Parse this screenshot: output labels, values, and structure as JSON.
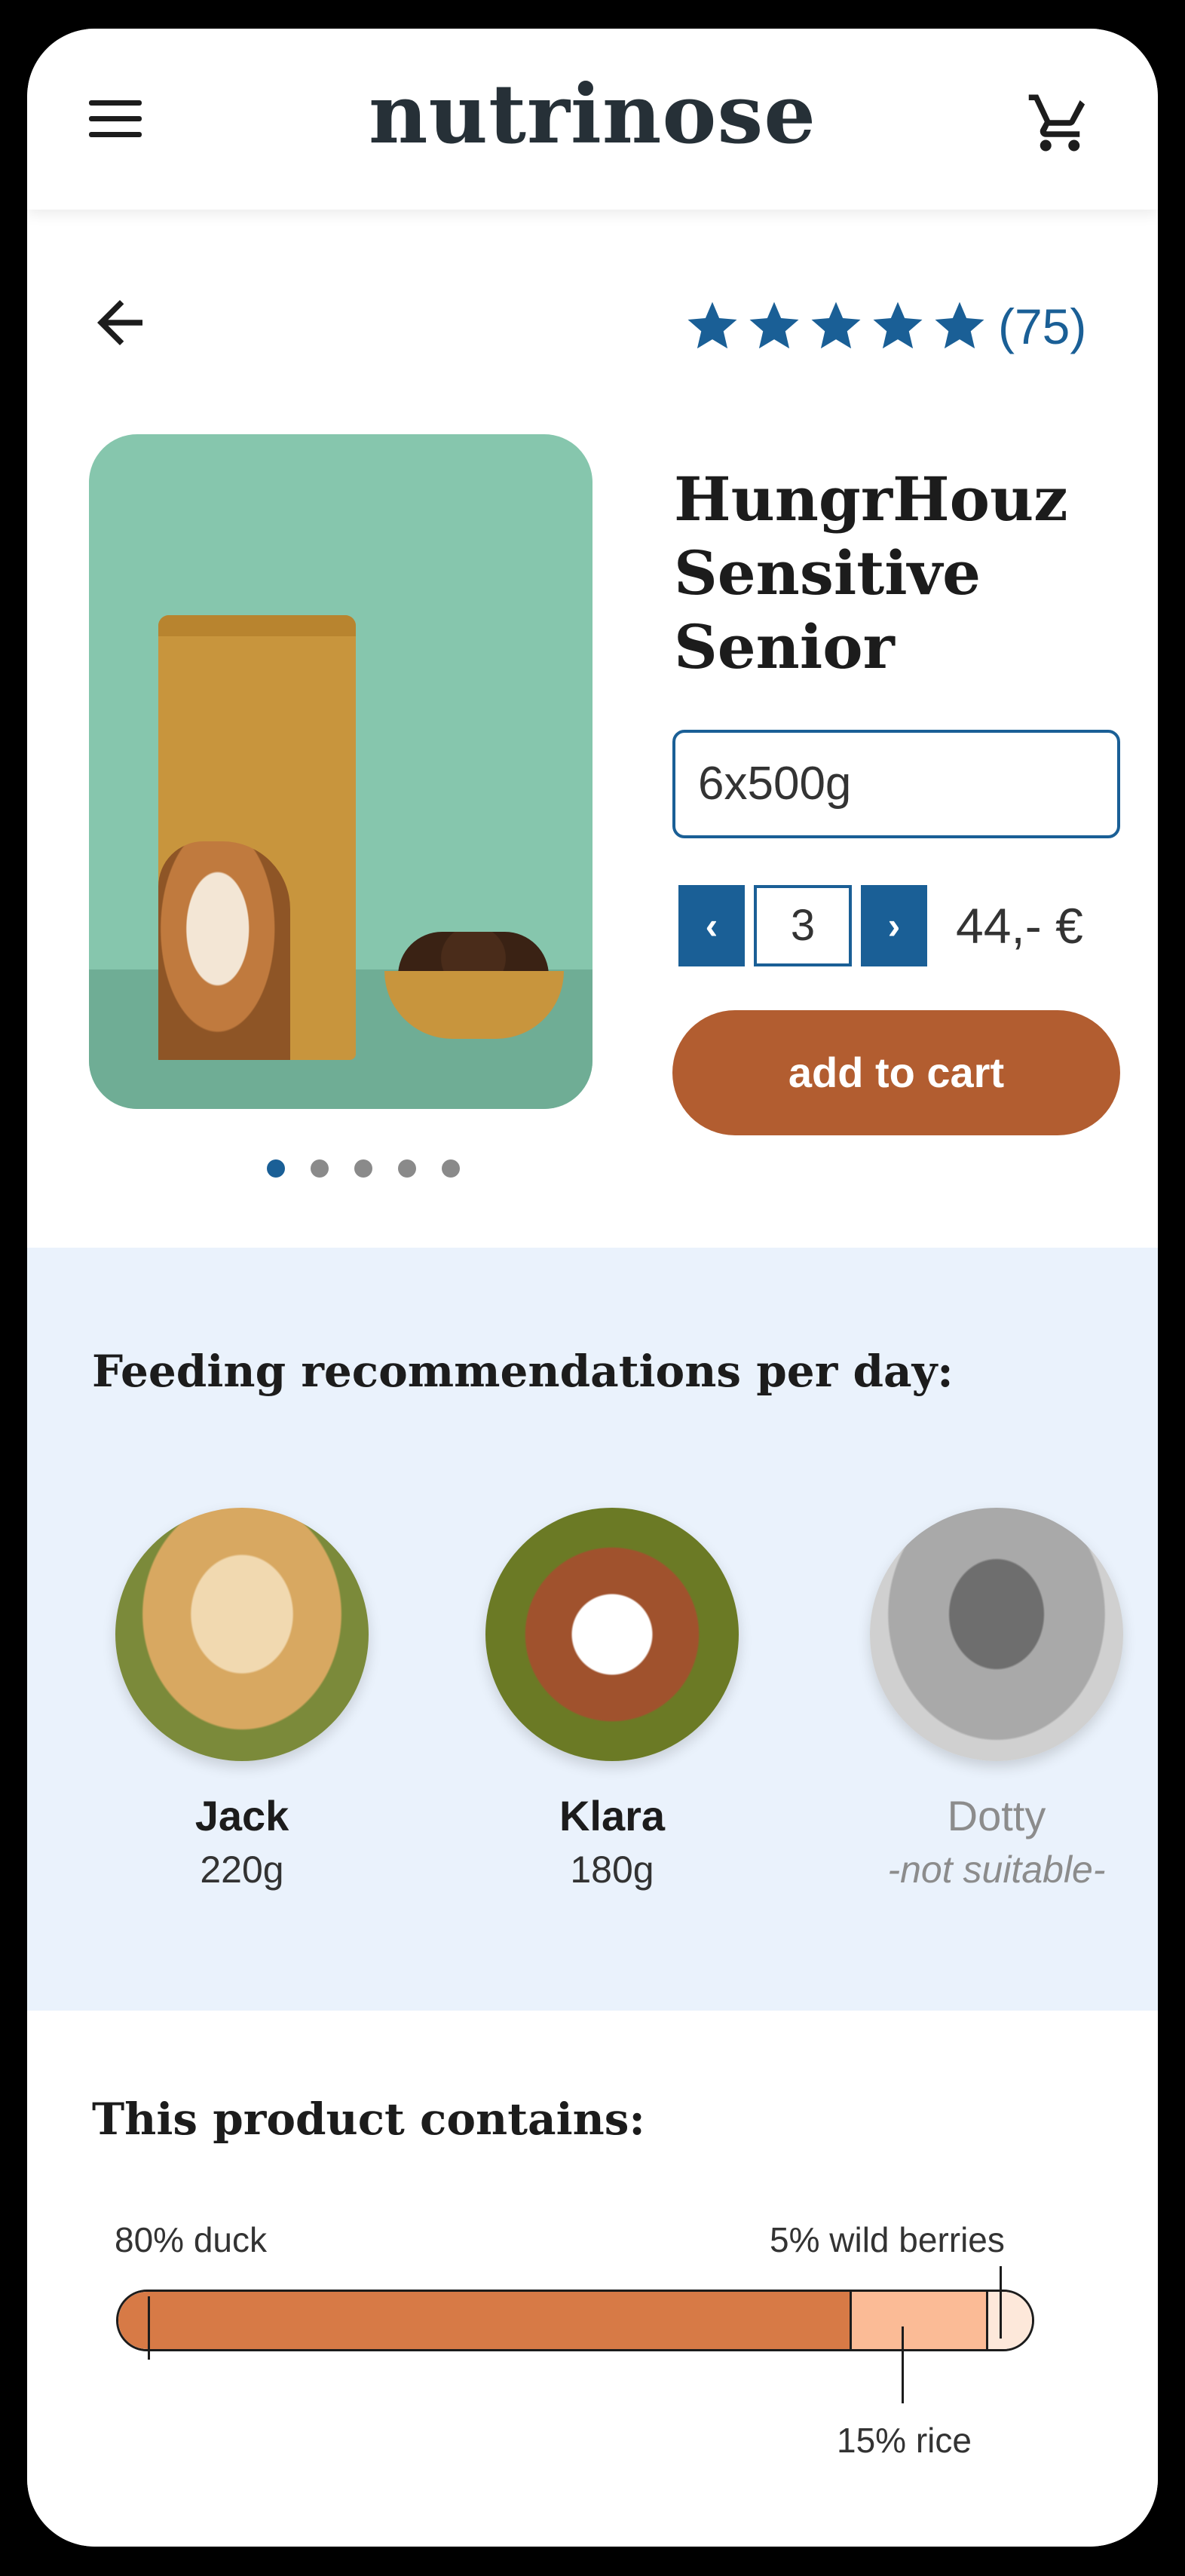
{
  "header": {
    "brand": "nutrinose",
    "menu_icon": "hamburger-menu-icon",
    "cart_icon": "shopping-cart-icon"
  },
  "product": {
    "back_icon": "arrow-left-icon",
    "rating_stars": 5,
    "rating_count": "(75)",
    "title_lines": [
      "HungrHouz",
      "Sensitive",
      "Senior"
    ],
    "size": "6x500g",
    "quantity": "3",
    "price": "44,- €",
    "add_to_cart": "add to cart",
    "gallery": {
      "count": 5,
      "active_index": 0
    }
  },
  "feeding": {
    "title": "Feeding recommendations per day:",
    "dogs": [
      {
        "name": "Jack",
        "amount": "220g",
        "suitable": true
      },
      {
        "name": "Klara",
        "amount": "180g",
        "suitable": true
      },
      {
        "name": "Dotty",
        "amount": "-not suitable-",
        "suitable": false
      }
    ]
  },
  "ingredients": {
    "title": "This product contains:",
    "items": [
      {
        "label": "80% duck",
        "percent": 80
      },
      {
        "label": "15% rice",
        "percent": 15
      },
      {
        "label": "5% wild berries",
        "percent": 5
      }
    ]
  },
  "colors": {
    "accent_blue": "#1a5f96",
    "cart_button": "#b25d30",
    "feeding_bg": "#eaf2fc",
    "duck": "#d77a46",
    "rice": "#fbbb96",
    "berries": "#fde8da"
  }
}
